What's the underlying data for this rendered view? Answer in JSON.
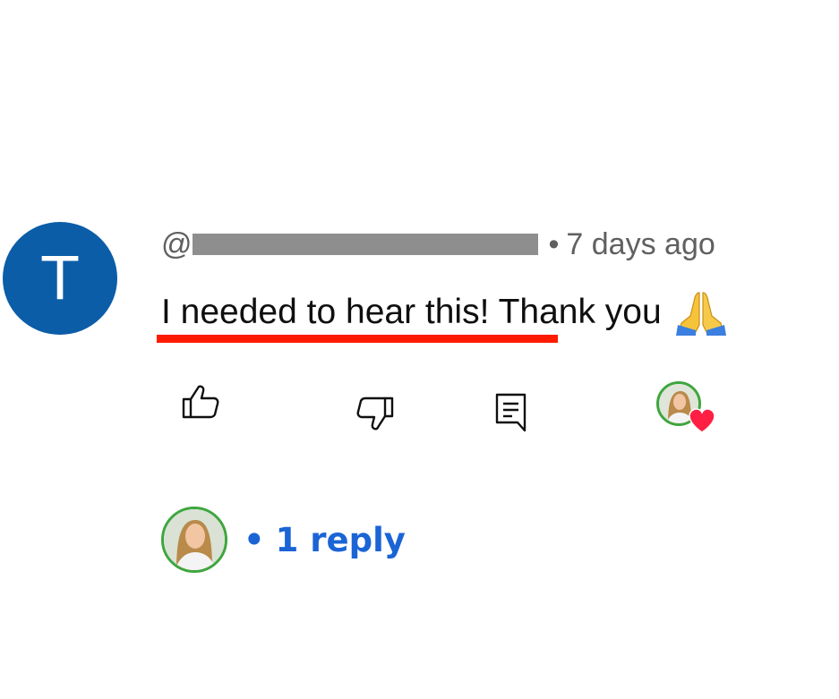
{
  "comment": {
    "avatar_letter": "T",
    "handle_prefix": "@",
    "separator": "•",
    "timestamp": "7 days ago",
    "text_underlined": "I needed to hear this!",
    "text_rest": " Thank you",
    "emoji": "🙏"
  },
  "actions": {
    "like_icon": "thumbs-up-icon",
    "dislike_icon": "thumbs-down-icon",
    "reply_icon": "comment-reply-icon",
    "creator_heart_icon": "heart-icon"
  },
  "replies": {
    "separator": "•",
    "label": "1 reply"
  },
  "colors": {
    "avatar_bg": "#0b5da8",
    "underline": "#ff1a00",
    "reply_link": "#1a64d6",
    "heart": "#ff1f43",
    "avatar_ring": "#3ea63e"
  }
}
